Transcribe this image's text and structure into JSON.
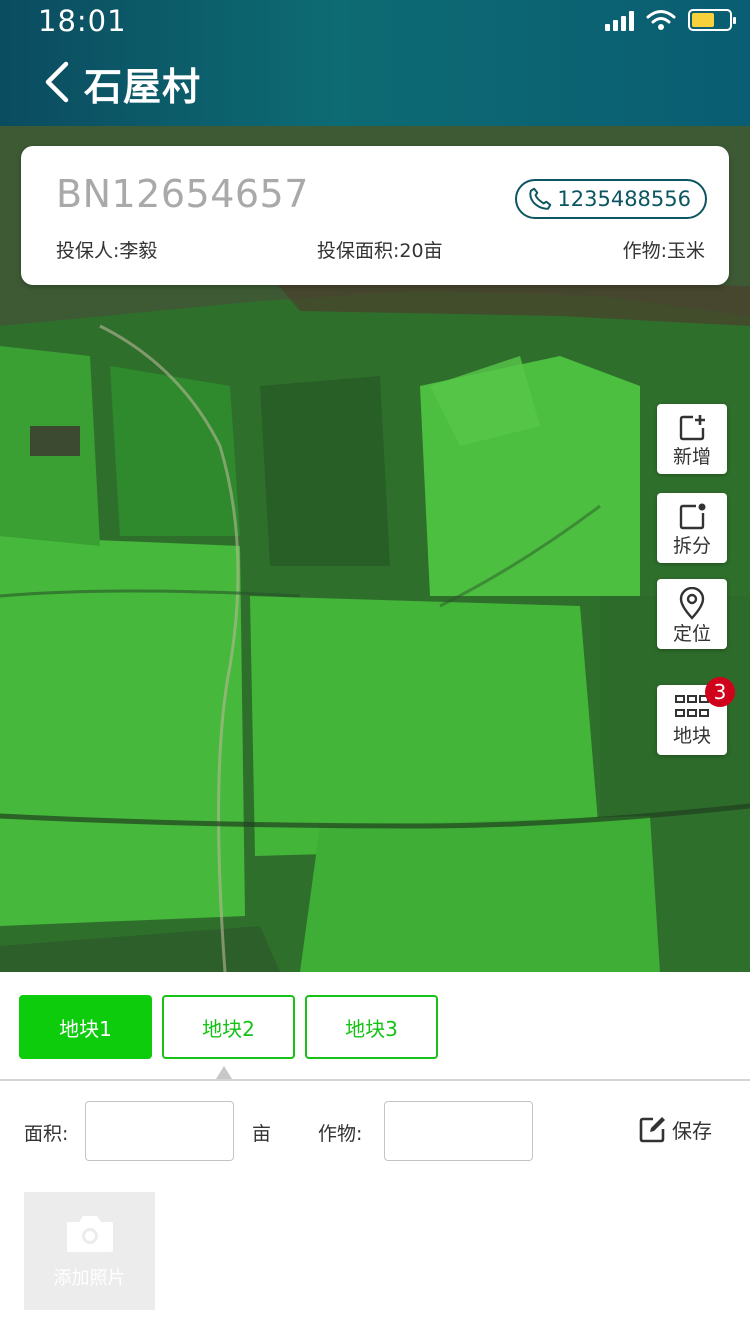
{
  "status_bar": {
    "time": "18:01"
  },
  "header": {
    "title": "石屋村"
  },
  "policy": {
    "number": "BN12654657",
    "phone": "1235488556",
    "holder": "投保人:李毅",
    "area": "投保面积:20亩",
    "crop": "作物:玉米"
  },
  "tools": [
    {
      "label": "新增",
      "icon": "add-note-icon"
    },
    {
      "label": "拆分",
      "icon": "split-icon"
    },
    {
      "label": "定位",
      "icon": "location-pin-icon"
    },
    {
      "label": "地块",
      "icon": "grid-icon",
      "badge": "3"
    }
  ],
  "plots": {
    "tabs": [
      "地块1",
      "地块2",
      "地块3"
    ],
    "active_index": 0
  },
  "form": {
    "area_label": "面积:",
    "area_value": "",
    "unit": "亩",
    "crop_label": "作物:",
    "crop_value": "",
    "save_label": "保存"
  },
  "photo": {
    "label": "添加照片"
  },
  "colors": {
    "header": "#0b5c6a",
    "accent_green": "#0ccc0c",
    "badge_red": "#d0021b"
  }
}
